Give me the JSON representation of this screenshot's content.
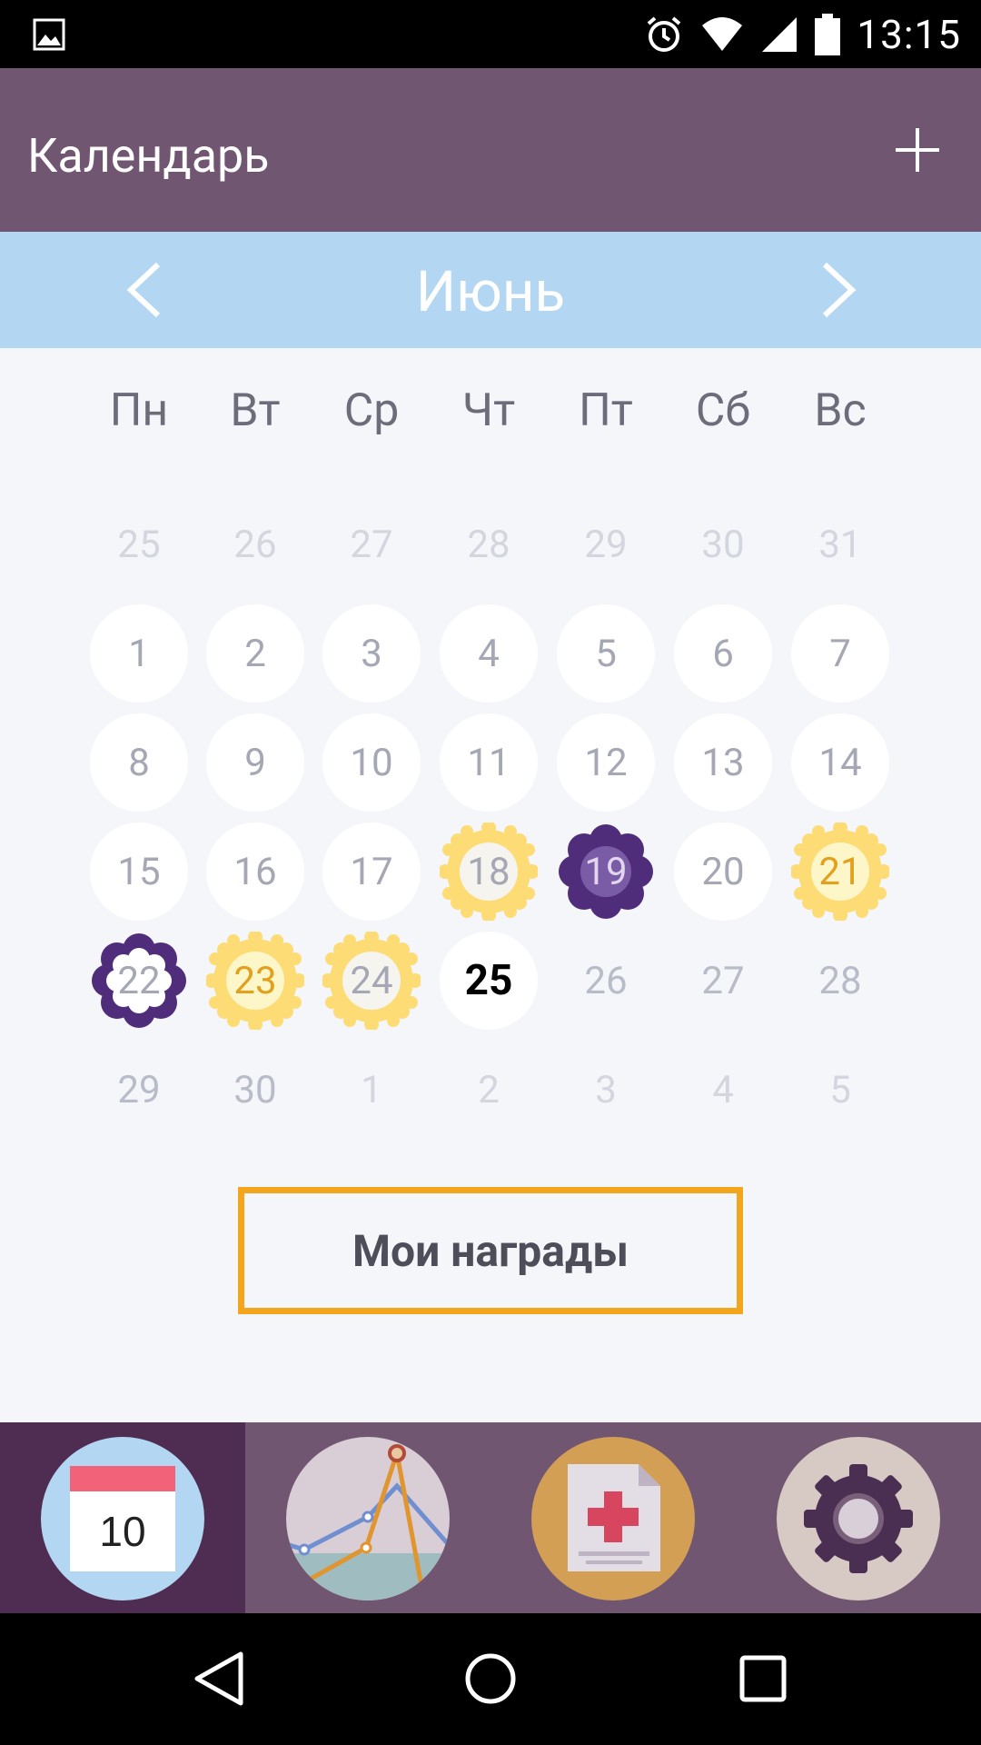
{
  "status_bar": {
    "time": "13:15",
    "icons": [
      "gallery-icon",
      "alarm-icon",
      "wifi-icon",
      "signal-icon",
      "battery-icon"
    ]
  },
  "app_bar": {
    "title": "Календарь",
    "add_icon": "plus-icon"
  },
  "month_bar": {
    "month": "Июнь",
    "prev_icon": "chevron-left-icon",
    "next_icon": "chevron-right-icon"
  },
  "weekdays": [
    "Пн",
    "Вт",
    "Ср",
    "Чт",
    "Пт",
    "Сб",
    "Вс"
  ],
  "days": [
    [
      "25",
      "26",
      "27",
      "28",
      "29",
      "30",
      "31"
    ],
    [
      "1",
      "2",
      "3",
      "4",
      "5",
      "6",
      "7"
    ],
    [
      "8",
      "9",
      "10",
      "11",
      "12",
      "13",
      "14"
    ],
    [
      "15",
      "16",
      "17",
      "18",
      "19",
      "20",
      "21"
    ],
    [
      "22",
      "23",
      "24",
      "25",
      "26",
      "27",
      "28"
    ],
    [
      "29",
      "30",
      "1",
      "2",
      "3",
      "4",
      "5"
    ]
  ],
  "rewards_button": "Мои награды",
  "bottom_nav": {
    "calendar_day": "10",
    "tabs": [
      "calendar-icon",
      "chart-icon",
      "medical-document-icon",
      "gear-icon"
    ]
  },
  "colors": {
    "app_bar": "#715671",
    "month_bar": "#b3d7f3",
    "accent_orange": "#f3a61b",
    "sun_yellow": "#fddc76",
    "flower_purple": "#4f2d7a"
  }
}
